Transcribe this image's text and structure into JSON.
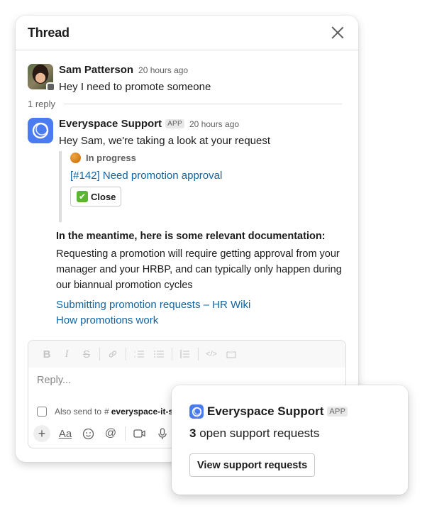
{
  "thread": {
    "title": "Thread",
    "close_icon": "close-icon"
  },
  "parent_message": {
    "sender": "Sam Patterson",
    "timestamp": "20 hours ago",
    "text": "Hey I need to promote someone",
    "avatar": "user-photo",
    "presence": "away"
  },
  "reply_count": "1 reply",
  "reply_message": {
    "sender": "Everyspace Support",
    "badge": "APP",
    "timestamp": "20 hours ago",
    "text": "Hey Sam, we're taking a look at your request",
    "attachment": {
      "status_icon": "orange-circle",
      "status": "In progress",
      "ticket_link": "[#142] Need promotion approval",
      "close_button": {
        "emoji": "✔",
        "label": "Close"
      }
    },
    "docs": {
      "heading": "In the meantime, here is some relevant documentation:",
      "text": "Requesting a promotion will require getting approval from your manager and your HRBP, and can typically only happen during our biannual promotion cycles",
      "links": [
        "Submitting promotion requests – HR Wiki",
        "How promotions work"
      ]
    }
  },
  "composer": {
    "formatting": [
      {
        "icon": "bold-icon",
        "glyph": "B"
      },
      {
        "icon": "italic-icon",
        "glyph": "I"
      },
      {
        "icon": "strikethrough-icon",
        "glyph": "S"
      },
      {
        "icon": "link-icon",
        "glyph": "🔗"
      },
      {
        "icon": "ordered-list-icon",
        "glyph": "≡"
      },
      {
        "icon": "bulleted-list-icon",
        "glyph": "☰"
      },
      {
        "icon": "blockquote-icon",
        "glyph": "❘≡"
      },
      {
        "icon": "code-icon",
        "glyph": "</>"
      },
      {
        "icon": "code-block-icon",
        "glyph": "⟨/⟩"
      }
    ],
    "placeholder": "Reply...",
    "also_send_label": "Also send to",
    "also_send_channel": "everyspace-it-s",
    "tools": {
      "plus": "+",
      "text_format": "Aa",
      "emoji": "☺",
      "mention": "@",
      "video": "▭",
      "microphone": "🎙"
    }
  },
  "popup": {
    "app_name": "Everyspace Support",
    "badge": "APP",
    "count": "3",
    "summary_text": "open support requests",
    "button_label": "View support requests"
  },
  "colors": {
    "link": "#1264a3",
    "app_brand": "#4a7bf0",
    "status_in_progress": "#e08a1e",
    "check_green": "#5cb531"
  }
}
